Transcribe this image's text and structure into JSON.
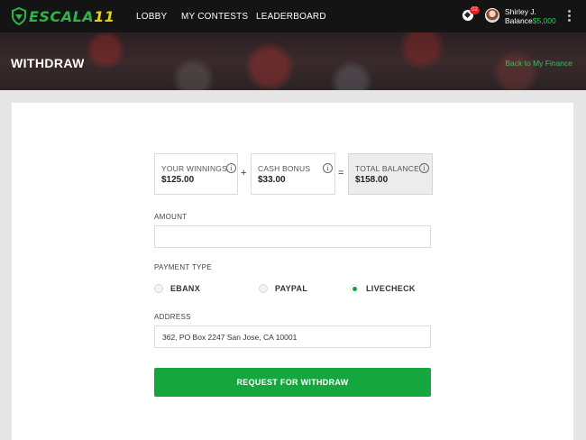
{
  "brand": {
    "logo_prefix": "ESCALA",
    "logo_suffix": "11"
  },
  "nav": {
    "items": [
      {
        "label": "LOBBY"
      },
      {
        "label": "MY CONTESTS"
      },
      {
        "label": "LEADERBOARD"
      }
    ]
  },
  "user": {
    "notification_count": "02",
    "name": "Shirley J.",
    "balance_label": "Balance",
    "balance_value": "$5,000"
  },
  "hero": {
    "title": "WITHDRAW",
    "back_link": "Back to My Finance"
  },
  "balances": {
    "winnings": {
      "label": "YOUR WINNINGS",
      "value": "$125.00"
    },
    "cash_bonus": {
      "label": "CASH BONUS",
      "value": "$33.00"
    },
    "total": {
      "label": "TOTAL BALANCE",
      "value": "$158.00"
    },
    "plus_sign": "+",
    "equals_sign": "=",
    "info_glyph": "i"
  },
  "form": {
    "amount_label": "AMOUNT",
    "amount_value": "",
    "payment_type_label": "PAYMENT TYPE",
    "payment_options": [
      {
        "label": "EBANX",
        "selected": false
      },
      {
        "label": "PAYPAL",
        "selected": false
      },
      {
        "label": "LIVECHECK",
        "selected": true
      }
    ],
    "address_label": "ADDRESS",
    "address_value": "362, PO Box 2247 San Jose, CA 10001",
    "submit_label": "REQUEST FOR WITHDRAW"
  },
  "colors": {
    "accent_green": "#16a63e",
    "topbar_bg": "#141414",
    "logo_yellow": "#e3d21c"
  },
  "icons": {
    "notifications": "soccer-ball-icon",
    "menu": "kebab-menu-icon",
    "info": "info-icon"
  }
}
